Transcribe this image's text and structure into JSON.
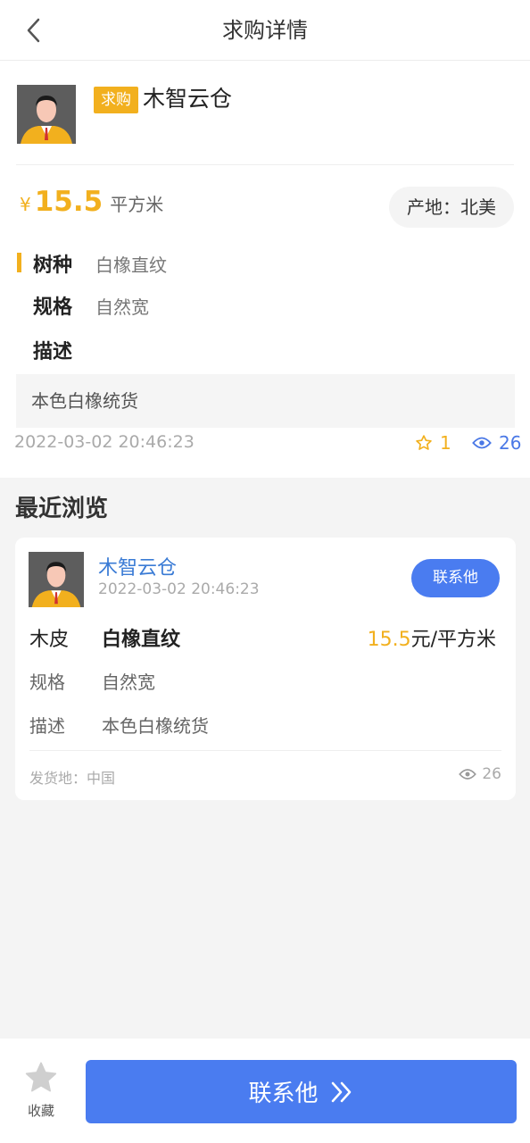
{
  "nav": {
    "title": "求购详情",
    "back_icon": "chevron-left-icon"
  },
  "detail": {
    "tag": "求购",
    "company": "木智云仓",
    "currency": "¥",
    "price": "15.5",
    "unit": "平方米",
    "origin": "产地：北美",
    "attrs": [
      {
        "label": "树种",
        "value": "白橡直纹"
      },
      {
        "label": "规格",
        "value": "自然宽"
      },
      {
        "label": "描述",
        "value": ""
      }
    ],
    "description": "本色白橡统货",
    "time": "2022-03-02 20:46:23",
    "favorites": "1",
    "views": "26"
  },
  "recent": {
    "title": "最近浏览",
    "card": {
      "company": "木智云仓",
      "time": "2022-03-02 20:46:23",
      "contact_label": "联系他",
      "type": "木皮",
      "species": "白橡直纹",
      "price_num": "15.5",
      "price_unit": "元/平方米",
      "spec_label": "规格",
      "spec_value": "自然宽",
      "desc_label": "描述",
      "desc_value": "本色白橡统货",
      "ship_from": "发货地：中国",
      "views": "26"
    }
  },
  "bottom": {
    "collect_label": "收藏",
    "contact_label": "联系他"
  },
  "colors": {
    "accent_orange": "#f2b01e",
    "accent_blue": "#4a7cf0",
    "link_blue": "#3a7bd5"
  }
}
